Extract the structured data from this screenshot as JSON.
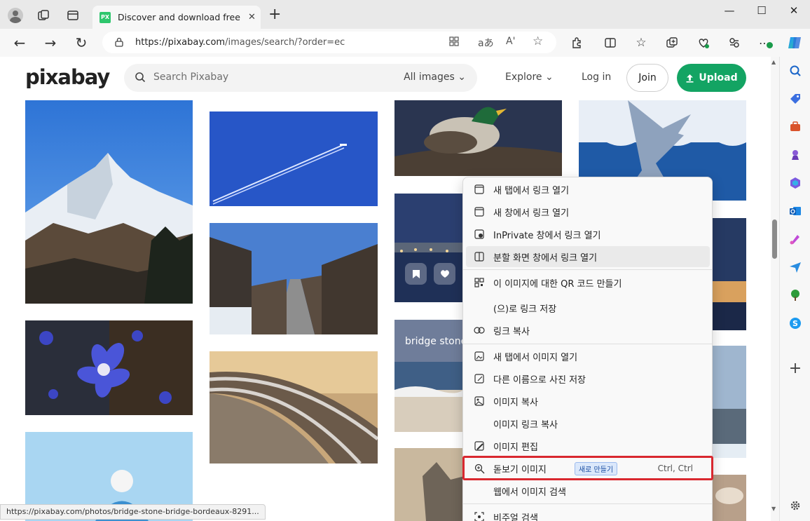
{
  "browser": {
    "tab_title": "Discover and download free images",
    "url_host": "https://pixabay.com",
    "url_path": "/images/search/?order=ec",
    "newtab_glyph": "+",
    "close_glyph": "✕",
    "minimize_glyph": "—",
    "maximize_glyph": "☐",
    "window_close_glyph": "✕",
    "back_glyph": "←",
    "forward_glyph": "→",
    "reload_glyph": "↻",
    "more_glyph": "⋯",
    "readaloud_text": "aあ",
    "immersive_text": "A'",
    "favicon_text": "PX"
  },
  "pixabay": {
    "logo": "pixabay",
    "search_placeholder": "Search Pixabay",
    "filter_label": "All images",
    "explore_label": "Explore",
    "login_label": "Log in",
    "join_label": "Join",
    "upload_label": "Upload",
    "bridge_caption": "bridge  stone",
    "brand_color": "#13a463"
  },
  "context_menu": {
    "items": [
      {
        "label": "새 탭에서 링크 열기",
        "icon": "new-tab-icon"
      },
      {
        "label": "새 창에서 링크 열기",
        "icon": "new-window-icon"
      },
      {
        "label": "InPrivate 창에서 링크 열기",
        "icon": "inprivate-icon"
      },
      {
        "label": "분할 화면 창에서 링크 열기",
        "icon": "split-screen-icon"
      },
      {
        "label": "이 이미지에 대한 QR 코드 만들기",
        "icon": "qr-code-icon"
      },
      {
        "label": "(으)로 링크 저장",
        "icon": ""
      },
      {
        "label": "링크 복사",
        "icon": "link-icon"
      },
      {
        "label": "새 탭에서 이미지 열기",
        "icon": "image-new-tab-icon"
      },
      {
        "label": "다른 이름으로 사진 저장",
        "icon": "save-image-icon"
      },
      {
        "label": "이미지 복사",
        "icon": "copy-image-icon"
      },
      {
        "label": "이미지 링크 복사",
        "icon": ""
      },
      {
        "label": "이미지 편집",
        "icon": "edit-image-icon"
      },
      {
        "label": "돋보기 이미지",
        "icon": "magnifier-icon"
      },
      {
        "label": "웹에서 이미지 검색",
        "icon": ""
      },
      {
        "label": "비주얼 검색",
        "icon": "visual-search-icon"
      }
    ],
    "new_badge": "새로 만들기",
    "shortcut": "Ctrl, Ctrl",
    "highlight_color": "#d9282f"
  },
  "status_bar": {
    "url": "https://pixabay.com/photos/bridge-stone-bridge-bordeaux-8291..."
  }
}
